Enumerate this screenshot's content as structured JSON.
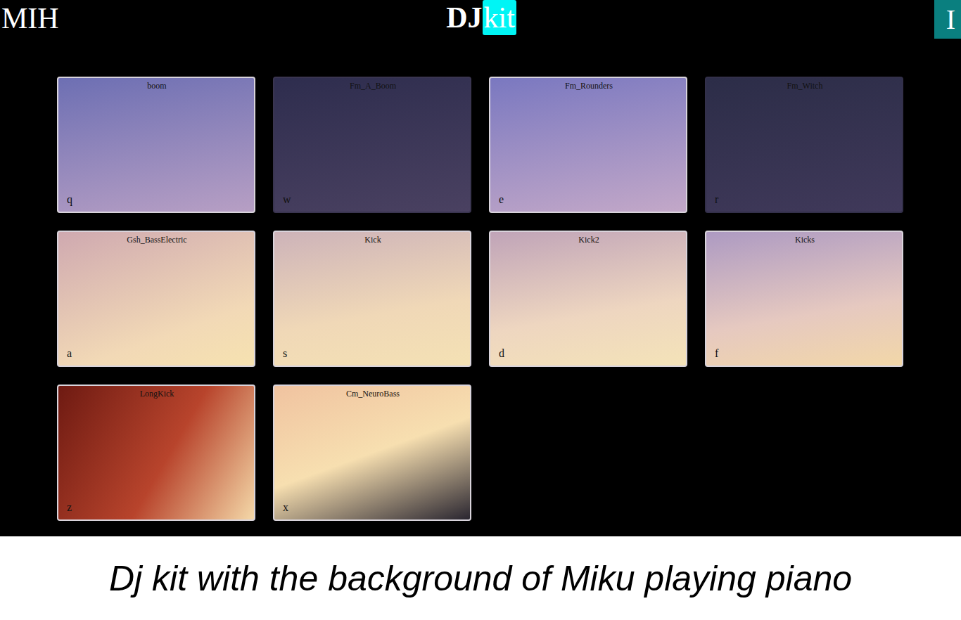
{
  "header": {
    "left_label": "MIH",
    "title_main": "DJ",
    "title_highlight": "kit",
    "right_button": "I"
  },
  "pads": [
    {
      "name": "boom",
      "key": "q"
    },
    {
      "name": "Fm_A_Boom",
      "key": "w"
    },
    {
      "name": "Fm_Rounders",
      "key": "e"
    },
    {
      "name": "Fm_Witch",
      "key": "r"
    },
    {
      "name": "Gsh_BassElectric",
      "key": "a"
    },
    {
      "name": "Kick",
      "key": "s"
    },
    {
      "name": "Kick2",
      "key": "d"
    },
    {
      "name": "Kicks",
      "key": "f"
    },
    {
      "name": "LongKick",
      "key": "z"
    },
    {
      "name": "Cm_NeuroBass",
      "key": "x"
    }
  ],
  "caption": "Dj kit with the background of Miku playing piano"
}
